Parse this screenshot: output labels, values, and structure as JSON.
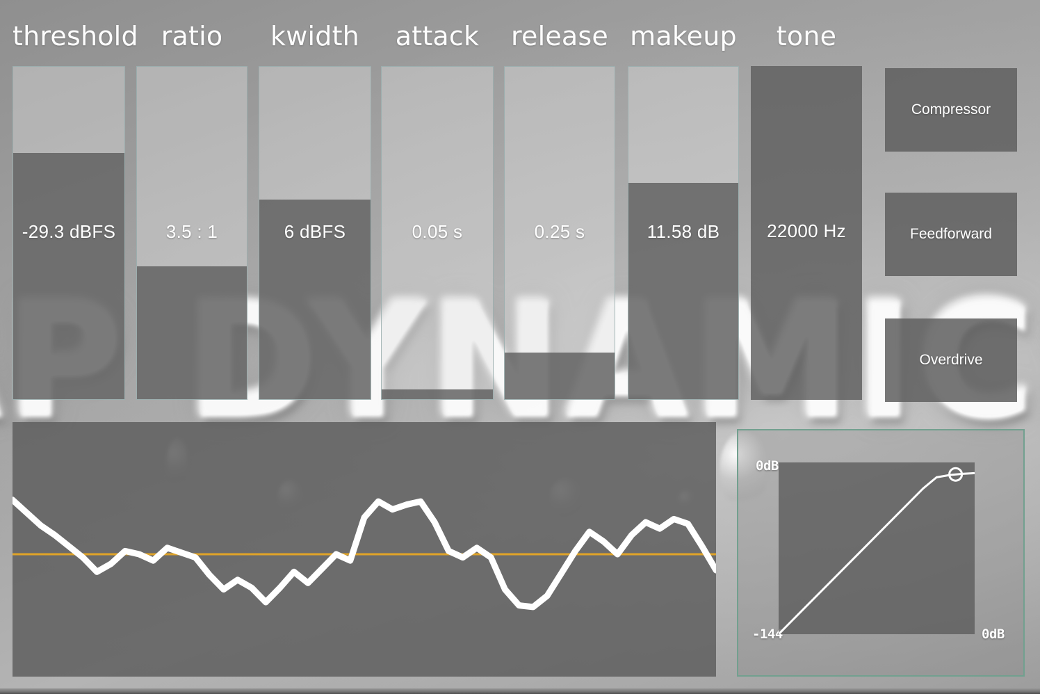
{
  "app": {
    "title": "ap dynamics",
    "watermark": "AP DYNAMICS"
  },
  "colors": {
    "background": "#9a9a9a",
    "slider_track": "#c9c9c9",
    "slider_fill": "#6d6d6d",
    "slider_border": "#93aaaa",
    "panel_fill": "#6b6b6b",
    "curve_border": "#72a08f",
    "threshold_line": "#e0a428",
    "waveform_line": "#ffffff",
    "text": "#ffffff"
  },
  "controls": [
    {
      "name": "threshold",
      "label": "threshold",
      "value": "-29.3 dBFS",
      "fill_percent": 74
    },
    {
      "name": "ratio",
      "label": "ratio",
      "value": "3.5 : 1",
      "fill_percent": 40
    },
    {
      "name": "kwidth",
      "label": "kwidth",
      "value": "6 dBFS",
      "fill_percent": 60
    },
    {
      "name": "attack",
      "label": "attack",
      "value": "0.05 s",
      "fill_percent": 3
    },
    {
      "name": "release",
      "label": "release",
      "value": "0.25 s",
      "fill_percent": 14
    },
    {
      "name": "makeup",
      "label": "makeup",
      "value": "11.58 dB",
      "fill_percent": 65
    },
    {
      "name": "tone",
      "label": "tone",
      "value": "22000 Hz",
      "fill_percent": 100
    }
  ],
  "mode_buttons": [
    {
      "name": "compressor",
      "label": "Compressor",
      "active": true
    },
    {
      "name": "feedforward",
      "label": "Feedforward",
      "active": true
    },
    {
      "name": "overdrive",
      "label": "Overdrive",
      "active": true
    }
  ],
  "transfer_curve": {
    "axis_top_label": "0dB",
    "axis_left_label": "-144",
    "axis_right_label": "0dB",
    "knee_handle_visible": true
  },
  "chart_data": [
    {
      "type": "line",
      "name": "waveform-display",
      "title": "",
      "xlabel": "",
      "ylabel": "",
      "ylim": [
        -1,
        1
      ],
      "grid": false,
      "legend": "none",
      "annotations": [
        {
          "type": "hline",
          "label": "threshold",
          "y": 0.0,
          "color": "#e0a428"
        }
      ],
      "x": [
        0,
        2,
        4,
        6,
        8,
        10,
        12,
        14,
        16,
        18,
        20,
        22,
        24,
        26,
        28,
        30,
        32,
        34,
        36,
        38,
        40,
        42,
        44,
        46,
        48,
        50,
        52,
        54,
        56,
        58,
        60,
        62,
        64,
        66,
        68,
        70,
        72,
        74,
        76,
        78,
        80,
        82,
        84,
        86,
        88,
        90,
        92,
        94,
        96,
        98,
        100
      ],
      "values": [
        0.34,
        0.26,
        0.18,
        0.12,
        0.05,
        -0.02,
        -0.11,
        -0.06,
        0.02,
        0.0,
        -0.04,
        0.04,
        0.01,
        -0.02,
        -0.13,
        -0.22,
        -0.16,
        -0.21,
        -0.3,
        -0.21,
        -0.11,
        -0.18,
        -0.09,
        0.0,
        -0.04,
        0.23,
        0.33,
        0.28,
        0.31,
        0.33,
        0.2,
        0.02,
        -0.02,
        0.04,
        -0.02,
        -0.22,
        -0.32,
        -0.33,
        -0.26,
        -0.12,
        0.02,
        0.14,
        0.08,
        0.0,
        0.12,
        0.2,
        0.16,
        0.22,
        0.19,
        0.05,
        -0.1
      ]
    },
    {
      "type": "line",
      "name": "transfer-curve",
      "title": "",
      "xlabel": "0dB",
      "ylabel": "0dB",
      "xlim": [
        -144,
        0
      ],
      "ylim": [
        -144,
        0
      ],
      "grid": false,
      "legend": "none",
      "x": [
        -144,
        -38,
        -28,
        -18,
        -8,
        0
      ],
      "values": [
        -144,
        -22,
        -12.5,
        -10.5,
        -9.5,
        -9.0
      ]
    }
  ]
}
